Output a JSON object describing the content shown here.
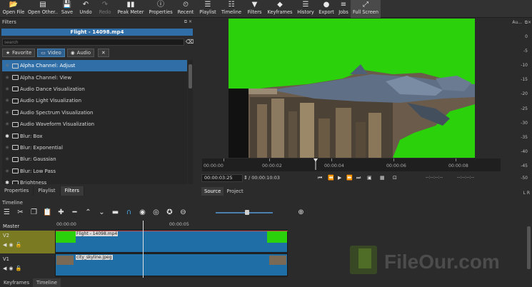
{
  "toolbar": {
    "items": [
      {
        "label": "Open File",
        "icon": "open-file-icon"
      },
      {
        "label": "Open Other..",
        "icon": "open-other-icon"
      },
      {
        "label": "Save",
        "icon": "save-icon"
      },
      {
        "label": "Undo",
        "icon": "undo-icon"
      },
      {
        "label": "Redo",
        "icon": "redo-icon"
      },
      {
        "label": "Peak Meter",
        "icon": "peak-meter-icon"
      },
      {
        "label": "Properties",
        "icon": "properties-icon"
      },
      {
        "label": "Recent",
        "icon": "recent-icon"
      },
      {
        "label": "Playlist",
        "icon": "playlist-icon"
      },
      {
        "label": "Timeline",
        "icon": "timeline-icon"
      },
      {
        "label": "Filters",
        "icon": "filters-icon"
      },
      {
        "label": "Keyframes",
        "icon": "keyframes-icon"
      },
      {
        "label": "History",
        "icon": "history-icon"
      },
      {
        "label": "Export",
        "icon": "export-icon"
      },
      {
        "label": "Jobs",
        "icon": "jobs-icon"
      },
      {
        "label": "Full Screen",
        "icon": "full-screen-icon"
      }
    ]
  },
  "filters_panel": {
    "title": "Filters",
    "clip_name": "Flight - 14098.mp4",
    "search_placeholder": "search",
    "tabs": {
      "favorite": "Favorite",
      "video": "Video",
      "audio": "Audio"
    },
    "items": [
      {
        "label": "Alpha Channel: Adjust",
        "favorite": false,
        "selected": true
      },
      {
        "label": "Alpha Channel: View",
        "favorite": false,
        "selected": false
      },
      {
        "label": "Audio Dance Visualization",
        "favorite": false,
        "selected": false
      },
      {
        "label": "Audio Light Visualization",
        "favorite": false,
        "selected": false
      },
      {
        "label": "Audio Spectrum Visualization",
        "favorite": false,
        "selected": false
      },
      {
        "label": "Audio Waveform Visualization",
        "favorite": false,
        "selected": false
      },
      {
        "label": "Blur: Box",
        "favorite": true,
        "selected": false
      },
      {
        "label": "Blur: Exponential",
        "favorite": false,
        "selected": false
      },
      {
        "label": "Blur: Gaussian",
        "favorite": false,
        "selected": false
      },
      {
        "label": "Blur: Low Pass",
        "favorite": false,
        "selected": false
      },
      {
        "label": "Brightness",
        "favorite": true,
        "selected": false
      }
    ]
  },
  "left_tabs": [
    "Properties",
    "Playlist",
    "Filters"
  ],
  "player": {
    "ruler_labels": [
      "00:00:00",
      "00:00:02",
      "00:00:04",
      "00:00:06",
      "00:00:08"
    ],
    "current_time": "00:00:03:25",
    "duration": "/ 00:00:10:03",
    "in_point": "--:--:--:--",
    "out_point": "--:--:--:--",
    "tabs": [
      "Source",
      "Project"
    ]
  },
  "audio_meter": {
    "header": "Au...",
    "labels": [
      "0",
      "-5",
      "-10",
      "-15",
      "-20",
      "-25",
      "-30",
      "-35",
      "-40",
      "-45",
      "-50"
    ],
    "channels": "L R"
  },
  "timeline": {
    "title": "Timeline",
    "ruler_labels": [
      "00:00:00",
      "00:00:05"
    ],
    "tracks": {
      "master": "Master",
      "v2": {
        "name": "V2",
        "clip": "Flight - 14098.mp4"
      },
      "v1": {
        "name": "V1",
        "clip": "city_skyline.jpeg"
      }
    }
  },
  "bottom_tabs": [
    "Keyframes",
    "Timeline"
  ],
  "watermark": "FileOur.com",
  "colors": {
    "accent": "#2f6ea6",
    "chroma_green": "#2bd10a",
    "track_clip": "#1f6fa6"
  }
}
